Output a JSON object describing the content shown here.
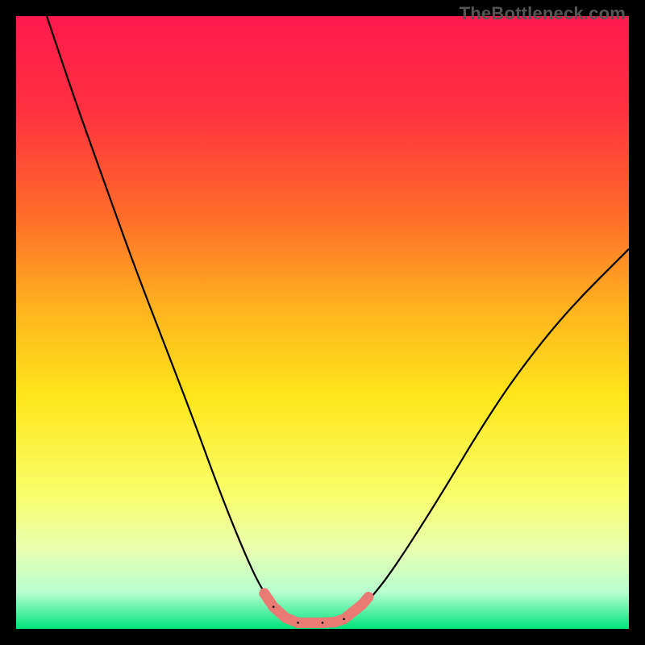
{
  "watermark": "TheBottleneck.com",
  "chart_data": {
    "type": "line",
    "title": "",
    "xlabel": "",
    "ylabel": "",
    "xlim": [
      0,
      100
    ],
    "ylim": [
      0,
      100
    ],
    "background_gradient": {
      "stops": [
        {
          "pos": 0.0,
          "color": "#ff1a4d"
        },
        {
          "pos": 0.15,
          "color": "#ff3040"
        },
        {
          "pos": 0.32,
          "color": "#ff6a2a"
        },
        {
          "pos": 0.48,
          "color": "#ffb41e"
        },
        {
          "pos": 0.62,
          "color": "#ffe61a"
        },
        {
          "pos": 0.78,
          "color": "#f8ff6a"
        },
        {
          "pos": 0.87,
          "color": "#e8ffb0"
        },
        {
          "pos": 0.94,
          "color": "#b8ffd0"
        },
        {
          "pos": 1.0,
          "color": "#00e47a"
        }
      ]
    },
    "series": [
      {
        "name": "bottleneck-curve",
        "color": "#000000",
        "points": [
          {
            "x": 5.0,
            "y": 100.0
          },
          {
            "x": 9.0,
            "y": 88.0
          },
          {
            "x": 14.0,
            "y": 74.0
          },
          {
            "x": 19.0,
            "y": 60.0
          },
          {
            "x": 24.0,
            "y": 47.0
          },
          {
            "x": 29.0,
            "y": 34.0
          },
          {
            "x": 33.0,
            "y": 23.0
          },
          {
            "x": 37.0,
            "y": 13.0
          },
          {
            "x": 40.0,
            "y": 6.5
          },
          {
            "x": 43.0,
            "y": 2.5
          },
          {
            "x": 46.0,
            "y": 1.0
          },
          {
            "x": 50.0,
            "y": 1.0
          },
          {
            "x": 53.0,
            "y": 1.3
          },
          {
            "x": 56.0,
            "y": 3.0
          },
          {
            "x": 60.0,
            "y": 7.5
          },
          {
            "x": 65.0,
            "y": 15.0
          },
          {
            "x": 70.0,
            "y": 23.0
          },
          {
            "x": 76.0,
            "y": 33.0
          },
          {
            "x": 82.0,
            "y": 42.0
          },
          {
            "x": 90.0,
            "y": 52.0
          },
          {
            "x": 100.0,
            "y": 62.0
          }
        ]
      }
    ],
    "markers": {
      "name": "valley-markers",
      "color": "#e97a74",
      "points": [
        {
          "x": 40.5,
          "y": 5.8
        },
        {
          "x": 42.0,
          "y": 3.6
        },
        {
          "x": 44.0,
          "y": 1.8
        },
        {
          "x": 46.0,
          "y": 1.0
        },
        {
          "x": 48.0,
          "y": 1.0
        },
        {
          "x": 50.0,
          "y": 1.0
        },
        {
          "x": 52.0,
          "y": 1.1
        },
        {
          "x": 53.5,
          "y": 1.6
        },
        {
          "x": 56.5,
          "y": 4.0
        },
        {
          "x": 57.5,
          "y": 5.2
        }
      ]
    }
  }
}
